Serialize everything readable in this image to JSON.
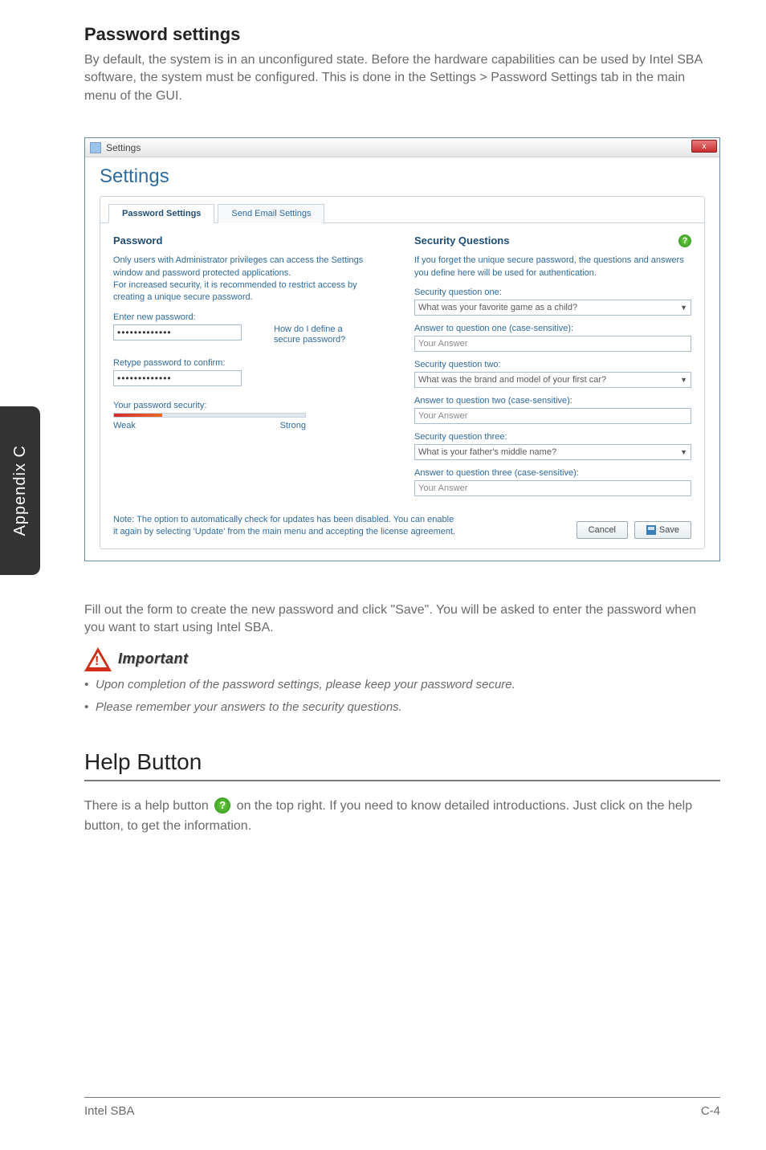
{
  "sidebar": {
    "label": "Appendix C"
  },
  "section": {
    "title": "Password settings",
    "paragraph": "By default, the system is in an unconfigured state. Before the hardware capabilities can be used by Intel SBA software, the system must be configured. This is done in the Settings > Password Settings tab in the main menu of the GUI."
  },
  "window": {
    "title": "Settings",
    "close_glyph": "x",
    "heading": "Settings",
    "tabs": {
      "password": "Password Settings",
      "email": "Send Email Settings"
    },
    "left": {
      "heading": "Password",
      "desc": "Only users with Administrator privileges can access the Settings window and password protected applications.\nFor increased security, it is recommended to restrict access by creating a unique secure password.",
      "enter_label": "Enter new password:",
      "pw_mask": "•••••••••••••",
      "hint_line1": "How do I define a",
      "hint_line2": "secure password?",
      "retype_label": "Retype password to confirm:",
      "pw_mask2": "•••••••••••••",
      "strength_label": "Your password security:",
      "weak": "Weak",
      "strong": "Strong"
    },
    "right": {
      "heading": "Security Questions",
      "desc": "If you forget the unique secure password, the questions and answers you define here will be used for authentication.",
      "q1_label": "Security question one:",
      "q1_value": "What was your favorite game as a child?",
      "a1_label": "Answer to question one (case-sensitive):",
      "a1_placeholder": "Your Answer",
      "q2_label": "Security question two:",
      "q2_value": "What was the brand and model of your first car?",
      "a2_label": "Answer to question two (case-sensitive):",
      "a2_placeholder": "Your Answer",
      "q3_label": "Security question three:",
      "q3_value": "What is your father's middle name?",
      "a3_label": "Answer to question three (case-sensitive):",
      "a3_placeholder": "Your Answer"
    },
    "note": "Note: The option to automatically check for updates has been disabled. You can enable it again by selecting 'Update' from the main menu and accepting the license agreement.",
    "buttons": {
      "cancel": "Cancel",
      "save": "Save"
    }
  },
  "post": {
    "paragraph": "Fill out the form to create the new password and click \"Save\". You will be asked to enter the password when you want to start using Intel SBA.",
    "important_label": "Important",
    "bullets": [
      "Upon completion of the password settings, please keep your password secure.",
      "Please remember your answers to the security questions."
    ]
  },
  "help_section": {
    "title": "Help Button",
    "text_before": "There is a help button ",
    "text_after": " on the top right. If you need to know detailed introductions. Just click on the help button, to get the information."
  },
  "footer": {
    "left": "Intel SBA",
    "right": "C-4"
  }
}
